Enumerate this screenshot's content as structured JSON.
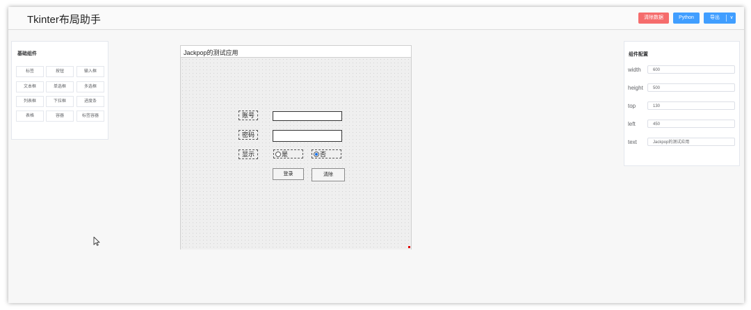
{
  "header": {
    "title": "Tkinter布局助手",
    "clear_label": "清除数据",
    "python_label": "Python",
    "export_label": "导出",
    "export_chevron": "∨"
  },
  "components_panel": {
    "title": "基础组件",
    "items": [
      "标签",
      "按钮",
      "输入框",
      "文本框",
      "单选框",
      "多选框",
      "列表框",
      "下拉框",
      "进度条",
      "表格",
      "容器",
      "标签容器"
    ]
  },
  "config_panel": {
    "title": "组件配置",
    "fields": [
      {
        "label": "width",
        "value": "600"
      },
      {
        "label": "height",
        "value": "500"
      },
      {
        "label": "top",
        "value": "130"
      },
      {
        "label": "left",
        "value": "450"
      },
      {
        "label": "text",
        "value": "Jackpop的测试应用"
      }
    ]
  },
  "canvas": {
    "window_title": "Jackpop的测试应用",
    "account_label": "账号",
    "password_label": "密码",
    "show_label": "显示",
    "radio_yes": "是",
    "radio_no": "否",
    "radio_selected": "否",
    "login_button": "登录",
    "clear_button": "清除"
  },
  "colors": {
    "danger": "#f56c6c",
    "primary": "#409eff",
    "resize_handle": "#e00000"
  },
  "icons": {
    "cursor": "arrow-cursor-icon",
    "dropdown": "chevron-down-icon"
  }
}
